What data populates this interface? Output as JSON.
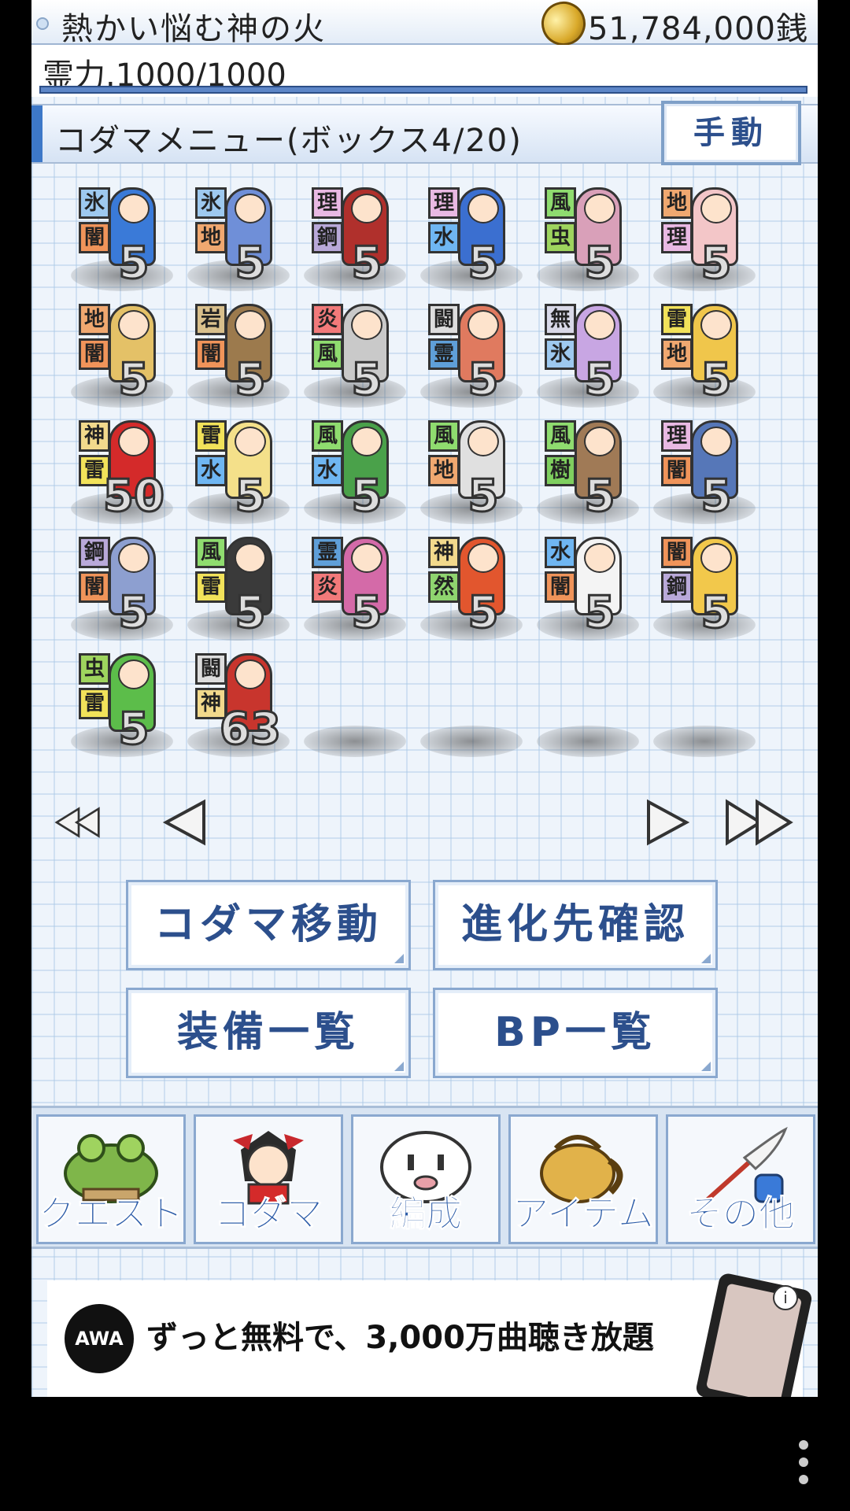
{
  "header": {
    "player_name": "熱かい悩む神の火",
    "money": "51,784,000銭"
  },
  "spirit": {
    "label": "霊力.1000/1000",
    "fill": 1.0
  },
  "title": {
    "label": "コダマメニュー(ボックス4/20)",
    "manual_button": "手動"
  },
  "kodama": [
    {
      "t1": "氷",
      "t2": "闇",
      "level": "5",
      "color": "#3a7ad8"
    },
    {
      "t1": "氷",
      "t2": "地",
      "level": "5",
      "color": "#6f8fd8"
    },
    {
      "t1": "理",
      "t2": "鋼",
      "level": "5",
      "color": "#b0302c"
    },
    {
      "t1": "理",
      "t2": "水",
      "level": "5",
      "color": "#3b6fd0"
    },
    {
      "t1": "風",
      "t2": "虫",
      "level": "5",
      "color": "#d9a0b9"
    },
    {
      "t1": "地",
      "t2": "理",
      "level": "5",
      "color": "#f3c6c8"
    },
    {
      "t1": "地",
      "t2": "闇",
      "level": "5",
      "color": "#e4c167"
    },
    {
      "t1": "岩",
      "t2": "闇",
      "level": "5",
      "color": "#9c7a4d"
    },
    {
      "t1": "炎",
      "t2": "風",
      "level": "5",
      "color": "#c9c9c9"
    },
    {
      "t1": "闘",
      "t2": "霊",
      "level": "5",
      "color": "#e07a5f"
    },
    {
      "t1": "無",
      "t2": "氷",
      "level": "5",
      "color": "#c8a6e3"
    },
    {
      "t1": "雷",
      "t2": "地",
      "level": "5",
      "color": "#f0c64b"
    },
    {
      "t1": "神",
      "t2": "雷",
      "level": "50",
      "color": "#d42a2a"
    },
    {
      "t1": "雷",
      "t2": "水",
      "level": "5",
      "color": "#f4e08a"
    },
    {
      "t1": "風",
      "t2": "水",
      "level": "5",
      "color": "#4aa14a"
    },
    {
      "t1": "風",
      "t2": "地",
      "level": "5",
      "color": "#e0e0e0"
    },
    {
      "t1": "風",
      "t2": "樹",
      "level": "5",
      "color": "#a07a56"
    },
    {
      "t1": "理",
      "t2": "闇",
      "level": "5",
      "color": "#5677b8"
    },
    {
      "t1": "鋼",
      "t2": "闇",
      "level": "5",
      "color": "#8d9fd0"
    },
    {
      "t1": "風",
      "t2": "雷",
      "level": "5",
      "color": "#3a3a3a"
    },
    {
      "t1": "霊",
      "t2": "炎",
      "level": "5",
      "color": "#d46aa8"
    },
    {
      "t1": "神",
      "t2": "然",
      "level": "5",
      "color": "#e2562e"
    },
    {
      "t1": "水",
      "t2": "闇",
      "level": "5",
      "color": "#f4f4f4"
    },
    {
      "t1": "闇",
      "t2": "鋼",
      "level": "5",
      "color": "#f2c84b"
    },
    {
      "t1": "虫",
      "t2": "雷",
      "level": "5",
      "color": "#5cbd4a"
    },
    {
      "t1": "闘",
      "t2": "神",
      "level": "63",
      "color": "#c8352d"
    }
  ],
  "type_colors": {
    "氷": "#9ec9ef",
    "闇": "#f0945a",
    "地": "#f0a870",
    "理": "#e9b9e3",
    "鋼": "#b9a9d9",
    "水": "#6fb6f2",
    "風": "#8fdc6f",
    "虫": "#9ed45e",
    "岩": "#d9c08c",
    "炎": "#f27a7a",
    "霊": "#5f9fd8",
    "無": "#d9d9e8",
    "雷": "#f2e25a",
    "神": "#f2d98c",
    "樹": "#7fcf5f",
    "然": "#8fd46f"
  },
  "nav_arrows": {
    "first": "first-page",
    "prev": "prev-page",
    "next": "next-page",
    "last": "last-page"
  },
  "menu_buttons": {
    "move": "コダマ移動",
    "evolution": "進化先確認",
    "equipment": "装備一覧",
    "bp": "BP一覧"
  },
  "bottom_nav": [
    {
      "label": "クエスト",
      "icon": "frog-icon"
    },
    {
      "label": "コダマ",
      "icon": "character-icon"
    },
    {
      "label": "編成",
      "icon": "ghost-icon"
    },
    {
      "label": "アイテム",
      "icon": "bag-icon"
    },
    {
      "label": "その他",
      "icon": "quill-icon"
    }
  ],
  "ad": {
    "logo": "AWA",
    "text": "ずっと無料で、3,000万曲聴き放題",
    "info": "i"
  }
}
